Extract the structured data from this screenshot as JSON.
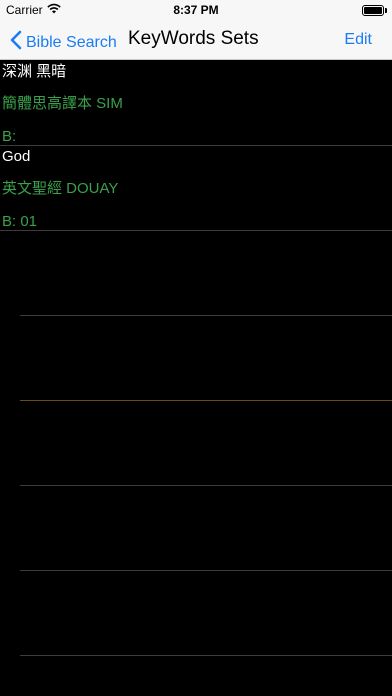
{
  "status_bar": {
    "carrier": "Carrier",
    "time": "8:37 PM",
    "battery_level": 1.0
  },
  "nav": {
    "back_label": "Bible Search",
    "title": "KeyWords Sets",
    "edit_label": "Edit"
  },
  "sets": [
    {
      "keywords": "深渊 黑暗",
      "translation": "簡體思高譯本 SIM",
      "books": "B:"
    },
    {
      "keywords": "God",
      "translation": "英文聖經 DOUAY",
      "books": "B: 01"
    }
  ],
  "colors": {
    "background": "#000000",
    "nav_background": "#f7f7f7",
    "accent": "#1a7cf5",
    "keyword_text": "#ffffff",
    "detail_text": "#3aa04a"
  },
  "icons": {
    "back": "chevron-left-icon",
    "wifi": "wifi-icon",
    "battery": "battery-icon"
  }
}
